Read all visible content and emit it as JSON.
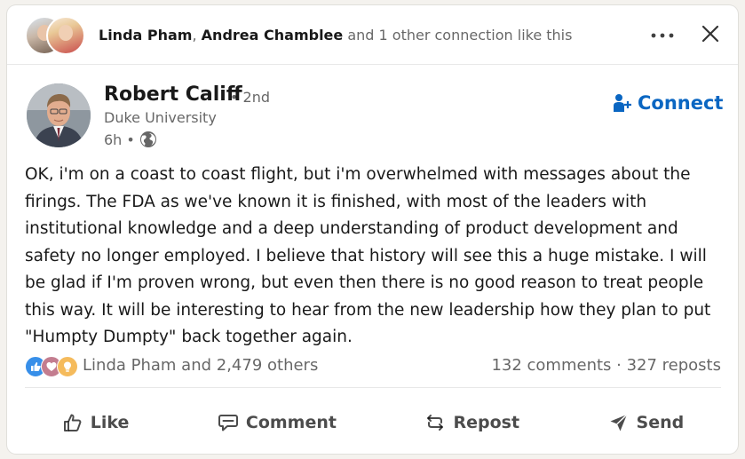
{
  "social_header": {
    "names": [
      "Linda Pham",
      "Andrea Chamblee"
    ],
    "separator": ",",
    "suffix": "and 1 other connection like this"
  },
  "author": {
    "name": "Robert Califf",
    "degree": "• 2nd",
    "headline": "Duke University",
    "time": "6h",
    "time_separator": "•",
    "visibility_icon": "globe-icon"
  },
  "connect": {
    "label": "Connect",
    "icon": "add-person-icon"
  },
  "post": {
    "text": "OK, i'm on a coast to coast flight, but i'm overwhelmed with messages about the firings. The FDA as we've known it is finished, with most of the leaders with institutional knowledge and a deep understanding of product development and safety no longer employed. I believe that history will see this a huge mistake. I will be glad if I'm proven wrong, but even then there is no good reason to treat people this way. It will be interesting to hear from the new leadership how they plan to put \"Humpty Dumpty\" back together again."
  },
  "counts": {
    "reactions_text": "Linda Pham and 2,479 others",
    "comments_reposts": "132 comments · 327 reposts",
    "reaction_icons": [
      "like-icon",
      "love-icon",
      "insightful-icon"
    ]
  },
  "actions": {
    "like": "Like",
    "comment": "Comment",
    "repost": "Repost",
    "send": "Send"
  },
  "colors": {
    "brand_blue": "#0a66c2",
    "like_blue": "#378fe9",
    "love": "#c37d8f",
    "insightful": "#f5bb5c"
  }
}
